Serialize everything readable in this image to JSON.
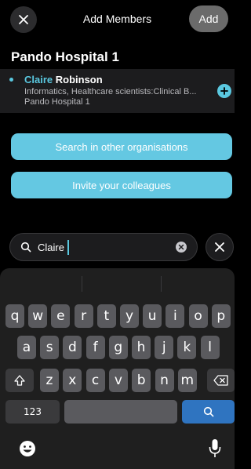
{
  "header": {
    "title": "Add Members",
    "add_label": "Add"
  },
  "org_title": "Pando Hospital 1",
  "member": {
    "name_match": "Claire",
    "name_rest": " Robinson",
    "role": "Informatics, Healthcare scientists:Clinical B...",
    "org": "Pando Hospital 1"
  },
  "buttons": {
    "search_other": "Search in other organisations",
    "invite": "Invite your colleagues"
  },
  "search": {
    "value": "Claire"
  },
  "colors": {
    "accent": "#5ac8e0",
    "button": "#64c8e2",
    "key_blue": "#2f74c0"
  },
  "keyboard": {
    "row1": [
      "q",
      "w",
      "e",
      "r",
      "t",
      "y",
      "u",
      "i",
      "o",
      "p"
    ],
    "row2": [
      "a",
      "s",
      "d",
      "f",
      "g",
      "h",
      "j",
      "k",
      "l"
    ],
    "row3": [
      "z",
      "x",
      "c",
      "v",
      "b",
      "n",
      "m"
    ],
    "numbers_label": "123",
    "shift_icon": "shift-icon",
    "backspace_icon": "backspace-icon",
    "search_icon": "search-icon",
    "emoji_icon": "emoji-icon",
    "mic_icon": "microphone-icon"
  }
}
